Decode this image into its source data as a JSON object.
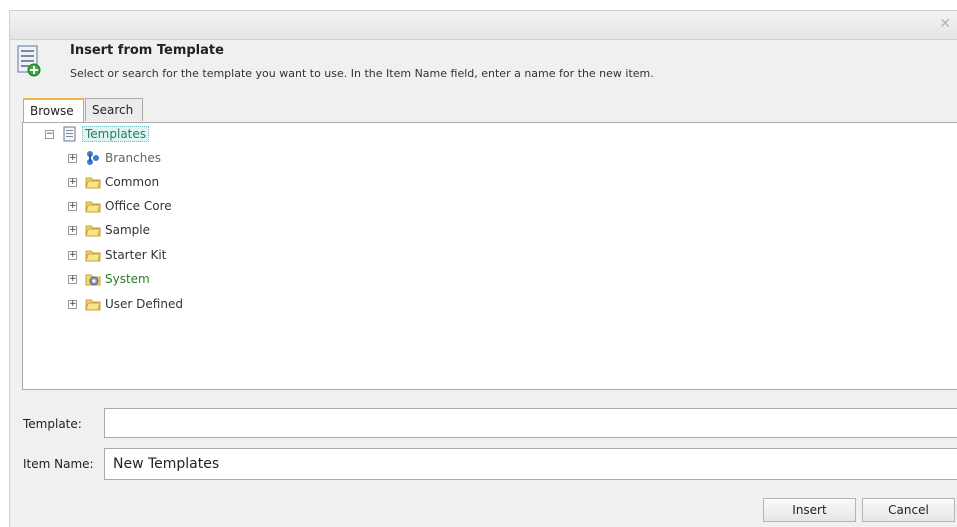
{
  "dialog": {
    "title": "Insert from Template",
    "description": "Select or search for the template you want to use. In the Item Name field, enter a name for the new item.",
    "close_glyph": "✕"
  },
  "tabs": [
    {
      "label": "Browse",
      "active": true
    },
    {
      "label": "Search",
      "active": false
    }
  ],
  "tree": {
    "root": {
      "label": "Templates",
      "expander": "−",
      "icon": "template-doc-icon"
    },
    "children": [
      {
        "label": "Branches",
        "expander": "+",
        "icon": "branches-icon"
      },
      {
        "label": "Common",
        "expander": "+",
        "icon": "folder-icon"
      },
      {
        "label": "Office Core",
        "expander": "+",
        "icon": "folder-icon"
      },
      {
        "label": "Sample",
        "expander": "+",
        "icon": "folder-icon"
      },
      {
        "label": "Starter Kit",
        "expander": "+",
        "icon": "folder-icon"
      },
      {
        "label": "System",
        "expander": "+",
        "icon": "system-folder-icon"
      },
      {
        "label": "User Defined",
        "expander": "+",
        "icon": "folder-icon"
      }
    ]
  },
  "form": {
    "template_label": "Template:",
    "template_value": "",
    "item_name_label": "Item Name:",
    "item_name_value": "New Templates"
  },
  "buttons": {
    "insert": "Insert",
    "cancel": "Cancel"
  },
  "colors": {
    "tab_accent": "#f0b34a",
    "system_text": "#2a7a2a",
    "folder": "#f5d36b"
  }
}
